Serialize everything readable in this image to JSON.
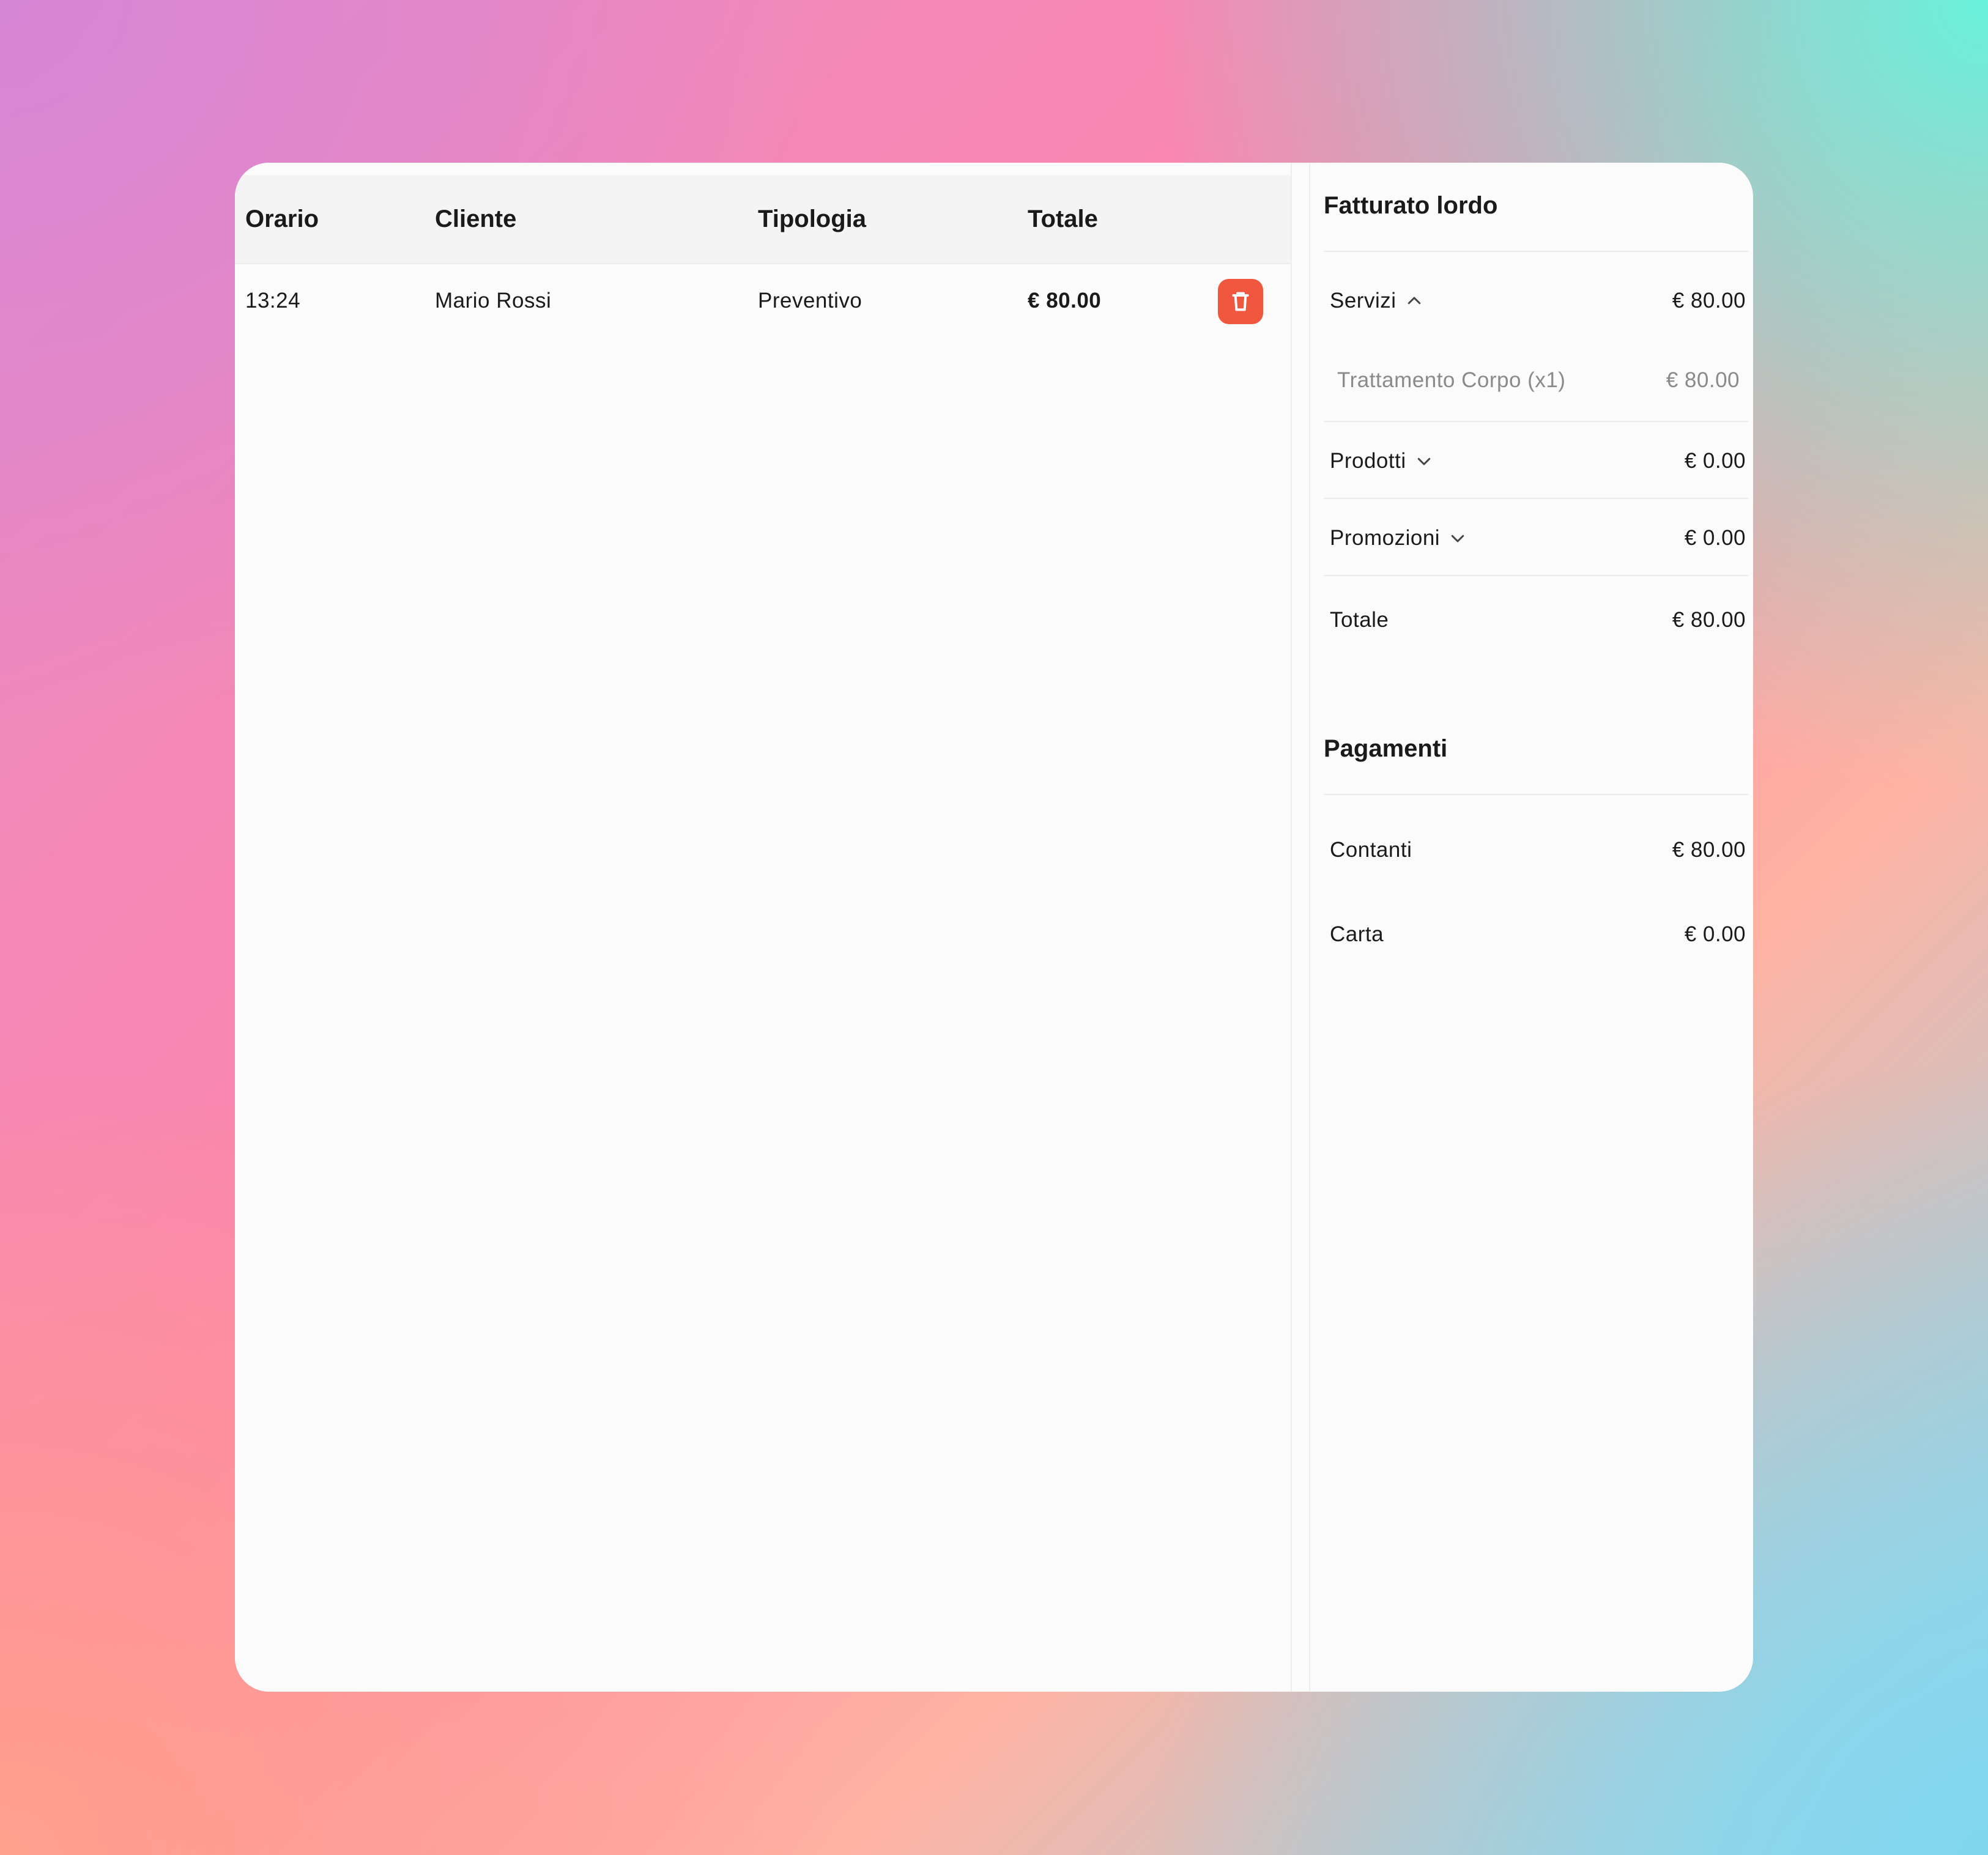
{
  "table": {
    "columns": {
      "time": "Orario",
      "client": "Cliente",
      "type": "Tipologia",
      "total": "Totale"
    },
    "rows": [
      {
        "time": "13:24",
        "client": "Mario Rossi",
        "type": "Preventivo",
        "total": "€ 80.00",
        "action_icon": "trash-icon"
      }
    ]
  },
  "summary": {
    "gross_title": "Fatturato lordo",
    "services": {
      "label": "Servizi",
      "value": "€ 80.00",
      "expanded": true,
      "items": [
        {
          "label": "Trattamento Corpo (x1)",
          "value": "€ 80.00"
        }
      ]
    },
    "products": {
      "label": "Prodotti",
      "value": "€ 0.00",
      "expanded": false
    },
    "promotions": {
      "label": "Promozioni",
      "value": "€ 0.00",
      "expanded": false
    },
    "total": {
      "label": "Totale",
      "value": "€ 80.00"
    },
    "payments_title": "Pagamenti",
    "payments": [
      {
        "label": "Contanti",
        "value": "€ 80.00"
      },
      {
        "label": "Carta",
        "value": "€ 0.00"
      }
    ]
  },
  "colors": {
    "delete_button": "#f0573f",
    "card_background": "#fbfbfb",
    "header_background": "#f4f4f4"
  }
}
